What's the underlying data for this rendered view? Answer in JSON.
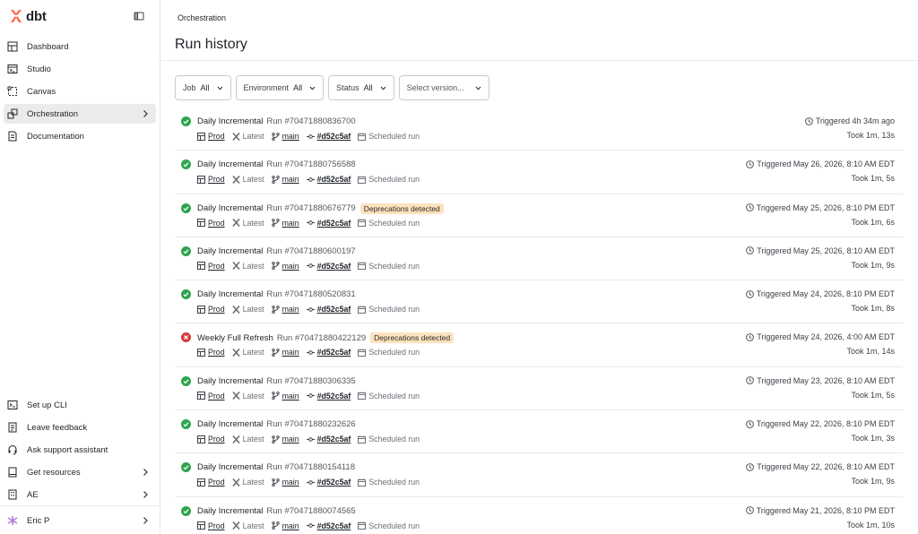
{
  "brand": {
    "name": "dbt",
    "accent": "#ff694a"
  },
  "sidebar": {
    "items": [
      {
        "label": "Dashboard",
        "icon": "dashboard-icon"
      },
      {
        "label": "Studio",
        "icon": "studio-icon"
      },
      {
        "label": "Canvas",
        "icon": "canvas-icon"
      },
      {
        "label": "Orchestration",
        "icon": "orchestration-icon",
        "active": true
      },
      {
        "label": "Documentation",
        "icon": "documentation-icon"
      }
    ],
    "bottom_items": [
      {
        "label": "Set up CLI",
        "icon": "terminal-icon"
      },
      {
        "label": "Leave feedback",
        "icon": "feedback-icon"
      },
      {
        "label": "Ask support assistant",
        "icon": "headset-icon"
      },
      {
        "label": "Get resources",
        "icon": "book-icon"
      },
      {
        "label": "AE",
        "icon": "building-icon"
      }
    ],
    "user": {
      "label": "Eric P",
      "icon": "user-avatar-icon",
      "avatar_color": "#b57bd6"
    }
  },
  "breadcrumb": "Orchestration",
  "page_title": "Run history",
  "filters": [
    {
      "label": "Job",
      "value": "All"
    },
    {
      "label": "Environment",
      "value": "All"
    },
    {
      "label": "Status",
      "value": "All"
    }
  ],
  "version_select": {
    "placeholder": "Select version..."
  },
  "status_colors": {
    "success": "#2ea44f",
    "error": "#d73a3a",
    "badge_bg": "#fde2bf"
  },
  "runs": [
    {
      "status": "success",
      "job": "Daily Incremental",
      "run_id": "Run #70471880836700",
      "badge": "",
      "env": "Prod",
      "version": "Latest",
      "branch": "main",
      "commit": "#d52c5af",
      "trigger": "Scheduled run",
      "triggered": "Triggered 4h 34m ago",
      "took": "Took 1m, 13s"
    },
    {
      "status": "success",
      "job": "Daily Incremental",
      "run_id": "Run #70471880756588",
      "badge": "",
      "env": "Prod",
      "version": "Latest",
      "branch": "main",
      "commit": "#d52c5af",
      "trigger": "Scheduled run",
      "triggered": "Triggered May 26, 2026, 8:10 AM EDT",
      "took": "Took 1m, 5s"
    },
    {
      "status": "success",
      "job": "Daily Incremental",
      "run_id": "Run #70471880676779",
      "badge": "Deprecations detected",
      "env": "Prod",
      "version": "Latest",
      "branch": "main",
      "commit": "#d52c5af",
      "trigger": "Scheduled run",
      "triggered": "Triggered May 25, 2026, 8:10 PM EDT",
      "took": "Took 1m, 6s"
    },
    {
      "status": "success",
      "job": "Daily Incremental",
      "run_id": "Run #70471880600197",
      "badge": "",
      "env": "Prod",
      "version": "Latest",
      "branch": "main",
      "commit": "#d52c5af",
      "trigger": "Scheduled run",
      "triggered": "Triggered May 25, 2026, 8:10 AM EDT",
      "took": "Took 1m, 9s"
    },
    {
      "status": "success",
      "job": "Daily Incremental",
      "run_id": "Run #70471880520831",
      "badge": "",
      "env": "Prod",
      "version": "Latest",
      "branch": "main",
      "commit": "#d52c5af",
      "trigger": "Scheduled run",
      "triggered": "Triggered May 24, 2026, 8:10 PM EDT",
      "took": "Took 1m, 8s"
    },
    {
      "status": "error",
      "job": "Weekly Full Refresh",
      "run_id": "Run #70471880422129",
      "badge": "Deprecations detected",
      "env": "Prod",
      "version": "Latest",
      "branch": "main",
      "commit": "#d52c5af",
      "trigger": "Scheduled run",
      "triggered": "Triggered May 24, 2026, 4:00 AM EDT",
      "took": "Took 1m, 14s"
    },
    {
      "status": "success",
      "job": "Daily Incremental",
      "run_id": "Run #70471880306335",
      "badge": "",
      "env": "Prod",
      "version": "Latest",
      "branch": "main",
      "commit": "#d52c5af",
      "trigger": "Scheduled run",
      "triggered": "Triggered May 23, 2026, 8:10 AM EDT",
      "took": "Took 1m, 5s"
    },
    {
      "status": "success",
      "job": "Daily Incremental",
      "run_id": "Run #70471880232626",
      "badge": "",
      "env": "Prod",
      "version": "Latest",
      "branch": "main",
      "commit": "#d52c5af",
      "trigger": "Scheduled run",
      "triggered": "Triggered May 22, 2026, 8:10 PM EDT",
      "took": "Took 1m, 3s"
    },
    {
      "status": "success",
      "job": "Daily Incremental",
      "run_id": "Run #70471880154118",
      "badge": "",
      "env": "Prod",
      "version": "Latest",
      "branch": "main",
      "commit": "#d52c5af",
      "trigger": "Scheduled run",
      "triggered": "Triggered May 22, 2026, 8:10 AM EDT",
      "took": "Took 1m, 9s"
    },
    {
      "status": "success",
      "job": "Daily Incremental",
      "run_id": "Run #70471880074565",
      "badge": "",
      "env": "Prod",
      "version": "Latest",
      "branch": "main",
      "commit": "#d52c5af",
      "trigger": "Scheduled run",
      "triggered": "Triggered May 21, 2026, 8:10 PM EDT",
      "took": "Took 1m, 10s"
    }
  ]
}
